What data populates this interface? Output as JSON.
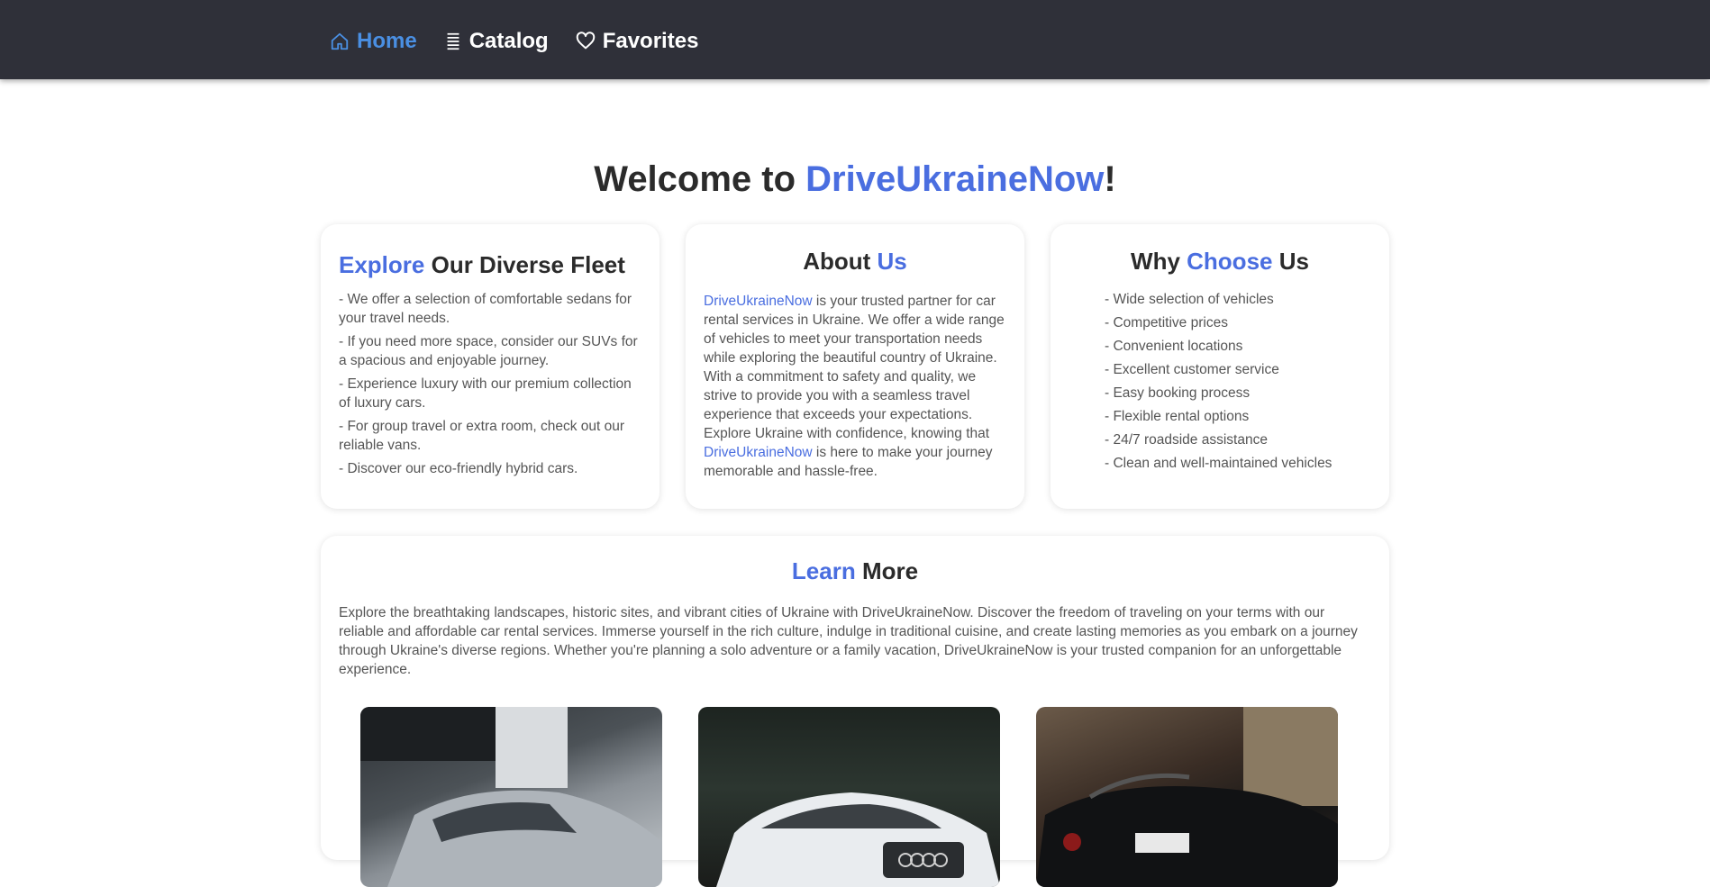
{
  "nav": {
    "items": [
      {
        "label": "Home",
        "icon": "home-icon",
        "active": true
      },
      {
        "label": "Catalog",
        "icon": "list-icon",
        "active": false
      },
      {
        "label": "Favorites",
        "icon": "heart-icon",
        "active": false
      }
    ]
  },
  "welcome": {
    "prefix": "Welcome to ",
    "brand": "DriveUkraineNow",
    "suffix": "!"
  },
  "fleet": {
    "title_accent": "Explore",
    "title_rest": " Our Diverse Fleet",
    "items": [
      "- We offer a selection of comfortable sedans for your travel needs.",
      "- If you need more space, consider our SUVs for a spacious and enjoyable journey.",
      "- Experience luxury with our premium collection of luxury cars.",
      "- For group travel or extra room, check out our reliable vans.",
      "- Discover our eco-friendly hybrid cars."
    ]
  },
  "about": {
    "title_rest": "About ",
    "title_accent": "Us",
    "link_1": "DriveUkraineNow",
    "text_1": " is your trusted partner for car rental services in Ukraine. We offer a wide range of vehicles to meet your transportation needs while exploring the beautiful country of Ukraine. With a commitment to safety and quality, we strive to provide you with a seamless travel experience that exceeds your expectations. Explore Ukraine with confidence, knowing that ",
    "link_2": "DriveUkraineNow",
    "text_2": " is here to make your journey memorable and hassle-free."
  },
  "why": {
    "title_pre": "Why ",
    "title_accent": "Choose",
    "title_post": " Us",
    "items": [
      "- Wide selection of vehicles",
      "- Competitive prices",
      "- Convenient locations",
      "- Excellent customer service",
      "- Easy booking process",
      "- Flexible rental options",
      "- 24/7 roadside assistance",
      "- Clean and well-maintained vehicles"
    ]
  },
  "learn": {
    "title_accent": "Learn",
    "title_rest": " More",
    "text": "Explore the breathtaking landscapes, historic sites, and vibrant cities of Ukraine with DriveUkraineNow. Discover the freedom of traveling on your terms with our reliable and affordable car rental services. Immerse yourself in the rich culture, indulge in traditional cuisine, and create lasting memories as you embark on a journey through Ukraine's diverse regions. Whether you're planning a solo adventure or a family vacation, DriveUkraineNow is your trusted companion for an unforgettable experience."
  },
  "colors": {
    "navbar_bg": "#2f3039",
    "nav_active": "#4a8fe3",
    "accent": "#4a6ee0",
    "text": "#2b2b2b",
    "body_text": "#555555"
  }
}
